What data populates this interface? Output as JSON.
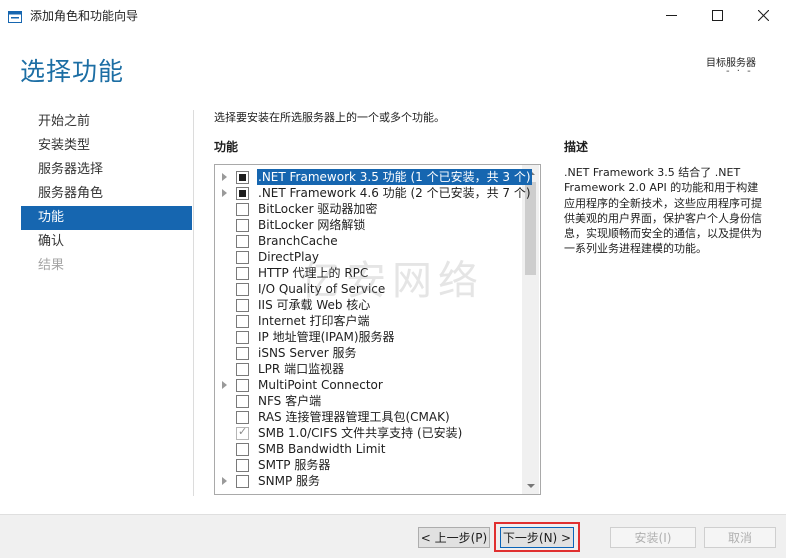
{
  "window": {
    "title": "添加角色和功能向导",
    "controls": {
      "minimize": "minimize-icon",
      "maximize": "maximize-icon",
      "close": "close-icon"
    }
  },
  "header": {
    "page_title": "选择功能",
    "destination_label": "目标服务器",
    "destination_value": "- · -"
  },
  "nav": {
    "items": [
      {
        "label": "开始之前",
        "state": "normal"
      },
      {
        "label": "安装类型",
        "state": "normal"
      },
      {
        "label": "服务器选择",
        "state": "normal"
      },
      {
        "label": "服务器角色",
        "state": "normal"
      },
      {
        "label": "功能",
        "state": "active"
      },
      {
        "label": "确认",
        "state": "normal"
      },
      {
        "label": "结果",
        "state": "disabled"
      }
    ]
  },
  "main": {
    "instruction": "选择要安装在所选服务器上的一个或多个功能。",
    "features_label": "功能",
    "features": [
      {
        "label": ".NET Framework 3.5 功能 (1 个已安装，共 3 个)",
        "expandable": true,
        "state": "partial",
        "selected": true
      },
      {
        "label": ".NET Framework 4.6 功能 (2 个已安装，共 7 个)",
        "expandable": true,
        "state": "partial",
        "selected": false
      },
      {
        "label": "BitLocker 驱动器加密",
        "expandable": false,
        "state": "unchecked",
        "selected": false
      },
      {
        "label": "BitLocker 网络解锁",
        "expandable": false,
        "state": "unchecked",
        "selected": false
      },
      {
        "label": "BranchCache",
        "expandable": false,
        "state": "unchecked",
        "selected": false
      },
      {
        "label": "DirectPlay",
        "expandable": false,
        "state": "unchecked",
        "selected": false
      },
      {
        "label": "HTTP 代理上的 RPC",
        "expandable": false,
        "state": "unchecked",
        "selected": false
      },
      {
        "label": "I/O Quality of Service",
        "expandable": false,
        "state": "unchecked",
        "selected": false
      },
      {
        "label": "IIS 可承载 Web 核心",
        "expandable": false,
        "state": "unchecked",
        "selected": false
      },
      {
        "label": "Internet 打印客户端",
        "expandable": false,
        "state": "unchecked",
        "selected": false
      },
      {
        "label": "IP 地址管理(IPAM)服务器",
        "expandable": false,
        "state": "unchecked",
        "selected": false
      },
      {
        "label": "iSNS Server 服务",
        "expandable": false,
        "state": "unchecked",
        "selected": false
      },
      {
        "label": "LPR 端口监视器",
        "expandable": false,
        "state": "unchecked",
        "selected": false
      },
      {
        "label": "MultiPoint Connector",
        "expandable": true,
        "state": "unchecked",
        "selected": false
      },
      {
        "label": "NFS 客户端",
        "expandable": false,
        "state": "unchecked",
        "selected": false
      },
      {
        "label": "RAS 连接管理器管理工具包(CMAK)",
        "expandable": false,
        "state": "unchecked",
        "selected": false
      },
      {
        "label": "SMB 1.0/CIFS 文件共享支持 (已安装)",
        "expandable": false,
        "state": "checked",
        "selected": false
      },
      {
        "label": "SMB Bandwidth Limit",
        "expandable": false,
        "state": "unchecked",
        "selected": false
      },
      {
        "label": "SMTP 服务器",
        "expandable": false,
        "state": "unchecked",
        "selected": false
      },
      {
        "label": "SNMP 服务",
        "expandable": true,
        "state": "unchecked",
        "selected": false
      }
    ],
    "description_label": "描述",
    "description_text": ".NET Framework 3.5 结合了 .NET Framework 2.0 API 的功能和用于构建应用程序的全新技术，这些应用程序可提供美观的用户界面，保护客户个人身份信息，实现顺畅而安全的通信，以及提供为一系列业务进程建模的功能。"
  },
  "watermark": "亿安网络",
  "footer": {
    "prev_label": "< 上一步(P)",
    "next_label": "下一步(N) >",
    "install_label": "安装(I)",
    "cancel_label": "取消"
  },
  "colors": {
    "accent": "#1666b0",
    "title": "#1c6ea4",
    "highlight": "#e03030"
  }
}
